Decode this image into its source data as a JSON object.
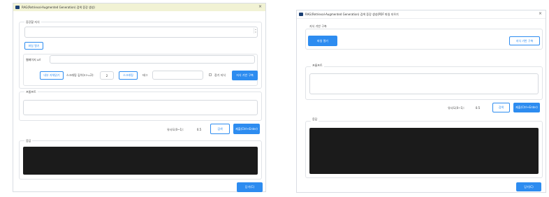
{
  "left": {
    "title": "RAG(Retrieval-Augmented Generation) 검색 증강 생성)",
    "section_knowledge": "증강할 지식",
    "file_button": "파일 열기",
    "webpage_label": "웹페이지 url",
    "scrape_internal_button": "내부 자체읽기",
    "scrape_depth_label": "스크래핑 깊이(n>=2):",
    "scrape_depth_value": "2",
    "scrape_button": "스크래핑",
    "tag_label": "태그",
    "split_label": "장기 지식",
    "build_button": "지식 기반 구축",
    "prompt_label": "프롬프트",
    "similarity_label": "유사도(0~1):",
    "similarity_value": "0.5",
    "search_button": "검색",
    "submit_button": "제출(Ctrl+Enter)",
    "answer_label": "응답",
    "close_button": "닫기(C)"
  },
  "right": {
    "title": "RAG(Retrieval-Augmented Generation) 검색 증강 생성(PDF 파일 지우기",
    "section_knowledge": "지식 기반 구축",
    "file_button": "파일 열기",
    "build_button": "지식 기반 구축",
    "prompt_label": "프롬프트",
    "similarity_label": "유사도(0~1):",
    "similarity_value": "0.5",
    "search_button": "검색",
    "submit_button": "제출(Ctrl+Enter)",
    "answer_label": "응답",
    "close_button": "닫기(C)"
  },
  "colors": {
    "accent": "#2d8cf0",
    "answer_bg": "#1b1b1b",
    "app_icon": "#1b3f73"
  },
  "icons": {
    "app": "app-icon",
    "close": "close-icon",
    "scroll": "scroll-arrows-icon"
  }
}
